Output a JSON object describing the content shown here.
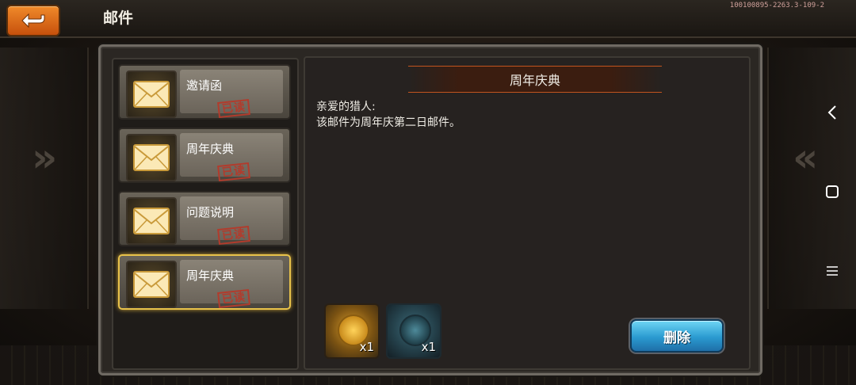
{
  "topbar": {
    "title": "邮件",
    "version": "100100895-2263.3-109-2",
    "back_icon": "back-arrow-icon"
  },
  "mail_list": [
    {
      "label": "邀请函",
      "status": "已读",
      "selected": false
    },
    {
      "label": "周年庆典",
      "status": "已读",
      "selected": false
    },
    {
      "label": "问题说明",
      "status": "已读",
      "selected": false
    },
    {
      "label": "周年庆典",
      "status": "已读",
      "selected": true
    }
  ],
  "mail": {
    "title": "周年庆典",
    "body_line1": "亲爱的猎人:",
    "body_line2": "该邮件为周年庆第二日邮件。",
    "rewards": [
      {
        "icon": "gold-coin-icon",
        "qty": "x1"
      },
      {
        "icon": "teal-token-icon",
        "qty": "x1"
      }
    ],
    "delete_label": "删除"
  },
  "nav": {
    "back_icon": "nav-back-icon",
    "home_icon": "nav-home-icon",
    "menu_icon": "nav-menu-icon"
  },
  "colors": {
    "accent_orange": "#e0762a",
    "selected_border": "#e8c24a",
    "read_stamp": "#b23b2c",
    "delete_button": "#2a9ad0"
  }
}
